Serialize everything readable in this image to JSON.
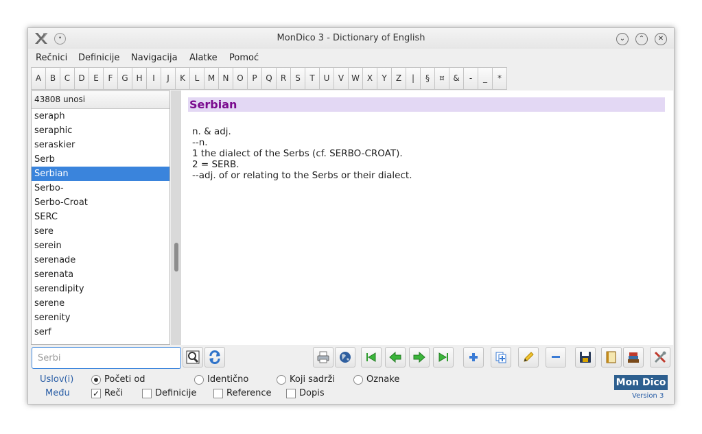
{
  "window": {
    "title": "MonDico 3 - Dictionary of English",
    "sticky_glyph": "•",
    "min_glyph": "⌄",
    "max_glyph": "⌃",
    "close_glyph": "✕"
  },
  "menu": [
    "Rečnici",
    "Definicije",
    "Navigacija",
    "Alatke",
    "Pomoć"
  ],
  "alphabet": [
    "A",
    "B",
    "C",
    "D",
    "E",
    "F",
    "G",
    "H",
    "I",
    "J",
    "K",
    "L",
    "M",
    "N",
    "O",
    "P",
    "Q",
    "R",
    "S",
    "T",
    "U",
    "V",
    "W",
    "X",
    "Y",
    "Z",
    "|",
    "§",
    "¤",
    "&",
    "-",
    "_",
    "*"
  ],
  "word_list": {
    "count_label": "43808 unosi",
    "items": [
      "seraph",
      "seraphic",
      "seraskier",
      "Serb",
      "Serbian",
      "Serbo-",
      "Serbo-Croat",
      "SERC",
      "sere",
      "serein",
      "serenade",
      "serenata",
      "serendipity",
      "serene",
      "serenity",
      "serf"
    ],
    "selected_index": 4,
    "scroll_fraction": 0.68
  },
  "definition": {
    "headword": "Serbian",
    "lines": [
      "n. & adj.",
      "--n.",
      "1 the dialect of the Serbs (cf. SERBO-CROAT).",
      "2 = SERB.",
      "--adj. of or relating to the Serbs or their dialect."
    ]
  },
  "search": {
    "value": "",
    "placeholder": "Serbi"
  },
  "toolbar_icons": [
    "search-icon",
    "refresh-icon",
    "print-icon",
    "globe-icon",
    "first-icon",
    "previous-icon",
    "next-icon",
    "last-icon",
    "add-icon",
    "add-copy-icon",
    "edit-icon",
    "remove-icon",
    "save-icon",
    "dictionary-icon",
    "books-icon",
    "tools-icon"
  ],
  "options": {
    "condition_label": "Uslov(i)",
    "among_label": "Među",
    "radios": [
      {
        "label": "Početi od",
        "checked": true
      },
      {
        "label": "Identično",
        "checked": false
      },
      {
        "label": "Koji sadrži",
        "checked": false
      },
      {
        "label": "Oznake",
        "checked": false
      }
    ],
    "checks": [
      {
        "label": "Reči",
        "checked": true
      },
      {
        "label": "Definicije",
        "checked": false
      },
      {
        "label": "Reference",
        "checked": false
      },
      {
        "label": "Dopis",
        "checked": false
      }
    ]
  },
  "logo": {
    "text": "Mon Dico",
    "version": "Version 3"
  },
  "colors": {
    "selection": "#3a84dc",
    "headword_bg": "#e3d8f4",
    "headword_text": "#7a0a8e",
    "accent_blue": "#2a5ea6"
  }
}
